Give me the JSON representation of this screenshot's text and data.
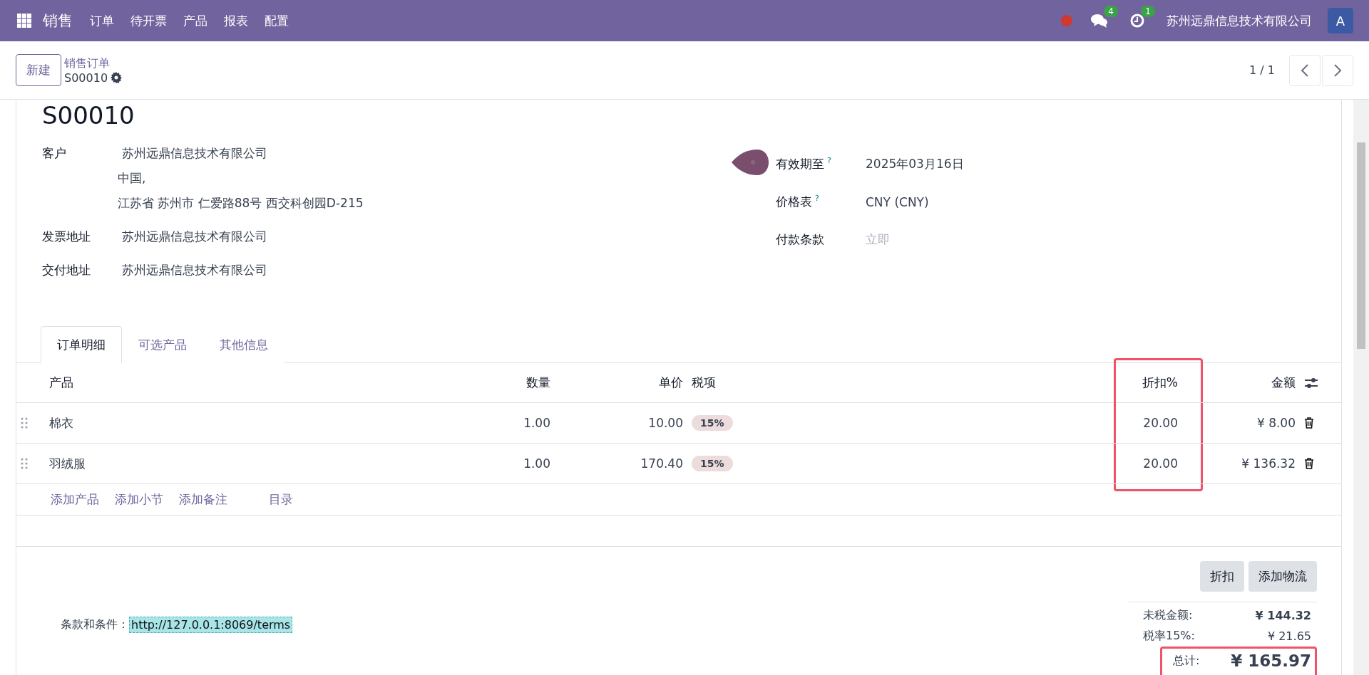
{
  "navbar": {
    "app_name": "销售",
    "menu": [
      "订单",
      "待开票",
      "产品",
      "报表",
      "配置"
    ],
    "messages_count": "4",
    "activities_count": "1",
    "company": "苏州远鼎信息技术有限公司",
    "avatar": "A"
  },
  "control_panel": {
    "new_button": "新建",
    "breadcrumb": "销售订单",
    "record_name": "S00010",
    "pager": "1 / 1"
  },
  "form": {
    "title": "S00010",
    "fields_left": [
      {
        "label": "客户",
        "lines": [
          "苏州远鼎信息技术有限公司",
          "中国,",
          "江苏省 苏州市 仁爱路88号 西交科创园D-215"
        ]
      },
      {
        "label": "发票地址",
        "lines": [
          "苏州远鼎信息技术有限公司"
        ]
      },
      {
        "label": "交付地址",
        "lines": [
          "苏州远鼎信息技术有限公司"
        ]
      }
    ],
    "fields_right": [
      {
        "label": "有效期至",
        "help": "?",
        "value": "2025年03月16日"
      },
      {
        "label": "价格表",
        "help": "?",
        "value": "CNY (CNY)"
      },
      {
        "label": "付款条款",
        "placeholder": "立即"
      }
    ]
  },
  "tabs": [
    {
      "label": "订单明细",
      "selected": true
    },
    {
      "label": "可选产品",
      "selected": false
    },
    {
      "label": "其他信息",
      "selected": false
    }
  ],
  "table": {
    "columns": [
      {
        "label": "产品",
        "highlighted": false
      },
      {
        "label": "数量",
        "highlighted": false
      },
      {
        "label": "单价",
        "highlighted": false
      },
      {
        "label": "税项",
        "highlighted": false
      },
      {
        "label": "折扣%",
        "highlighted": true
      },
      {
        "label": "金额",
        "highlighted": false
      }
    ],
    "rows": [
      {
        "product": "棉衣",
        "quantity": "1.00",
        "unit_price": "10.00",
        "tax": "15%",
        "discount": "20.00",
        "amount": "¥ 8.00"
      },
      {
        "product": "羽绒服",
        "quantity": "1.00",
        "unit_price": "170.40",
        "tax": "15%",
        "discount": "20.00",
        "amount": "¥ 136.32"
      }
    ],
    "add_links": [
      "添加产品",
      "添加小节",
      "添加备注",
      "目录"
    ]
  },
  "buttons": [
    "折扣",
    "添加物流"
  ],
  "terms": {
    "label": "条款和条件：",
    "value": "http://127.0.0.1:8069/terms"
  },
  "totals": [
    {
      "kind": "subtotal",
      "label": "未税金额:",
      "value": "¥ 144.32",
      "highlighted": false
    },
    {
      "kind": "tax",
      "label": "税率15%:",
      "value": "¥ 21.65",
      "highlighted": false
    },
    {
      "kind": "total",
      "label": "总计:",
      "value": "¥ 165.97",
      "highlighted": true
    }
  ]
}
